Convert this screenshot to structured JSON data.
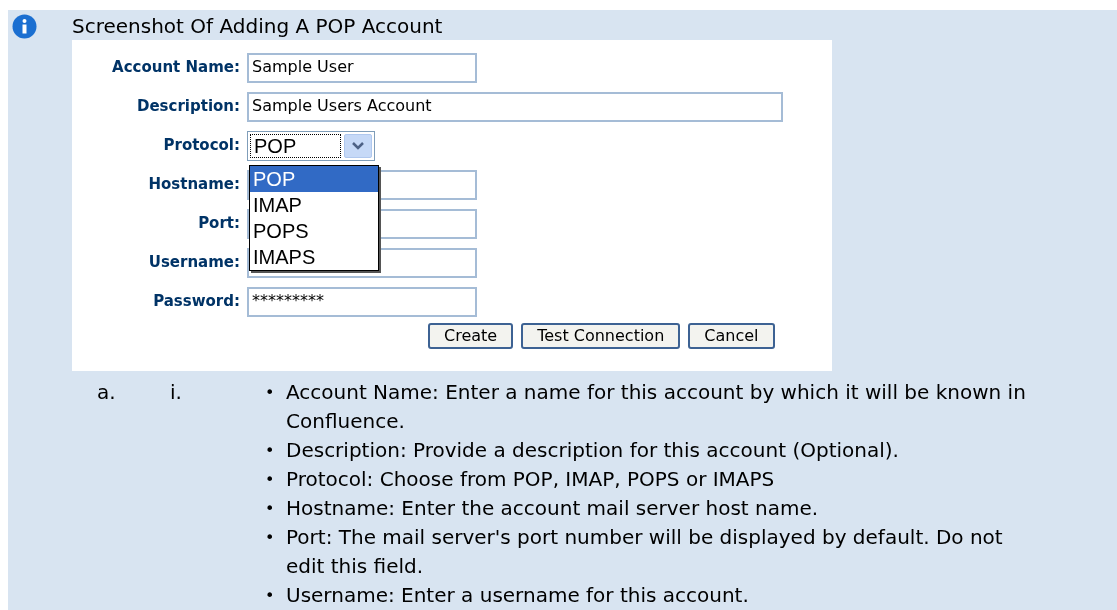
{
  "info_panel": {
    "title": "Screenshot Of Adding A POP Account",
    "form": {
      "fields": [
        {
          "label": "Account Name:",
          "kind": "text",
          "value": "Sample User"
        },
        {
          "label": "Description:",
          "kind": "text",
          "value": "Sample Users Account"
        },
        {
          "label": "Protocol:",
          "kind": "select",
          "value": "POP",
          "expanded": true,
          "options": [
            {
              "label": "POP",
              "selected": true
            },
            {
              "label": "IMAP",
              "selected": false
            },
            {
              "label": "POPS",
              "selected": false
            },
            {
              "label": "IMAPS",
              "selected": false
            }
          ]
        },
        {
          "label": "Hostname:",
          "kind": "text"
        },
        {
          "label": "Port:",
          "kind": "text"
        },
        {
          "label": "Username:",
          "kind": "text"
        },
        {
          "label": "Password:",
          "kind": "password",
          "value": "*********"
        }
      ],
      "buttons": [
        "Create",
        "Test Connection",
        "Cancel"
      ]
    },
    "list": {
      "outer_marker": "a.",
      "inner_marker": "i.",
      "items": [
        {
          "bullet": "•",
          "text": "Account Name: Enter a name for this account by which it will be known in Confluence."
        },
        {
          "bullet": "•",
          "text": "Description: Provide a description for this account (Optional)."
        },
        {
          "bullet": "•",
          "text": "Protocol: Choose from POP, IMAP, POPS or IMAPS"
        },
        {
          "bullet": "•",
          "text": "Hostname: Enter the account mail server host name."
        },
        {
          "bullet": "•",
          "text": "Port: The mail server's port number will be displayed by default. Do not edit this field."
        },
        {
          "bullet": "•",
          "text": "Username: Enter a username for this account."
        }
      ]
    }
  }
}
